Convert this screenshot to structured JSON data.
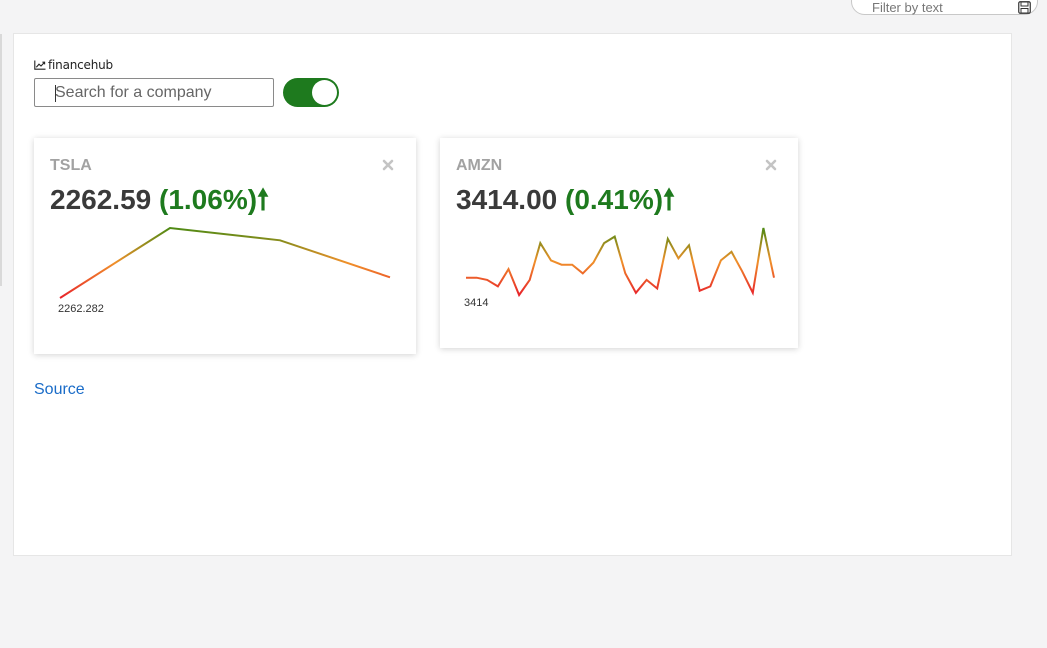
{
  "filter": {
    "placeholder": "Filter by text",
    "icon": "save-icon"
  },
  "app": {
    "logo_text": "financehub",
    "logo_icon": "chart-line-icon"
  },
  "search": {
    "placeholder": "Search for a company",
    "value": ""
  },
  "toggle": {
    "state": "on",
    "color": "#1e7a1e"
  },
  "colors": {
    "up": "#1e7a1e",
    "down": "#e8232a",
    "mid": "#f0902a",
    "link": "#1a6cc8"
  },
  "cards": [
    {
      "ticker": "TSLA",
      "price": "2262.59",
      "change": "(1.06%)",
      "arrow": "🠕",
      "close_icon": "close-icon",
      "spark_label": "2262.282",
      "series": [
        2262.3,
        2285.0,
        2281.0,
        2269.0
      ]
    },
    {
      "ticker": "AMZN",
      "price": "3414.00",
      "change": "(0.41%)",
      "arrow": "🠕",
      "close_icon": "close-icon",
      "spark_label": "3414",
      "series": [
        3420,
        3420,
        3419,
        3416,
        3424,
        3412,
        3419,
        3436,
        3428,
        3426,
        3426,
        3422,
        3427,
        3436,
        3439,
        3422,
        3413,
        3419,
        3415,
        3438,
        3429,
        3435,
        3414,
        3416,
        3428,
        3432,
        3423,
        3413,
        3443,
        3420
      ]
    }
  ],
  "footer": {
    "source_label": "Source"
  }
}
